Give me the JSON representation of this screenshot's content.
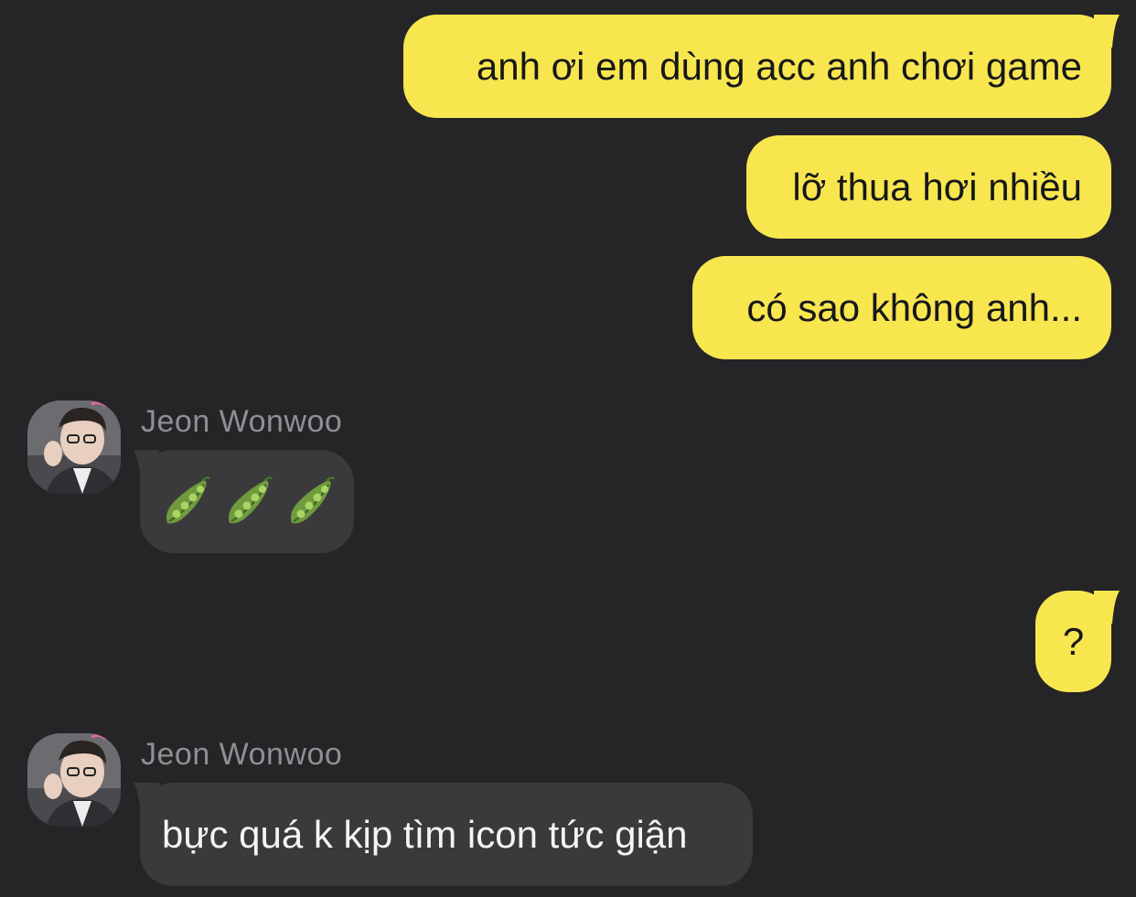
{
  "conversation": {
    "messages": [
      {
        "dir": "out",
        "text": "anh ơi em dùng acc anh chơi game"
      },
      {
        "dir": "out",
        "text": "lỡ thua hơi nhiều"
      },
      {
        "dir": "out",
        "text": "có sao không anh..."
      },
      {
        "dir": "in",
        "sender": "Jeon Wonwoo",
        "emoji": "pea-pod-icon",
        "emoji_count": 3
      },
      {
        "dir": "out",
        "text": "?"
      },
      {
        "dir": "in",
        "sender": "Jeon Wonwoo",
        "text": "bực quá k kịp tìm icon tức giận"
      }
    ]
  },
  "colors": {
    "background": "#252527",
    "outgoing_bubble": "#f8e64f",
    "incoming_bubble": "#3a3a3d",
    "sender_name": "#8f8f94"
  }
}
